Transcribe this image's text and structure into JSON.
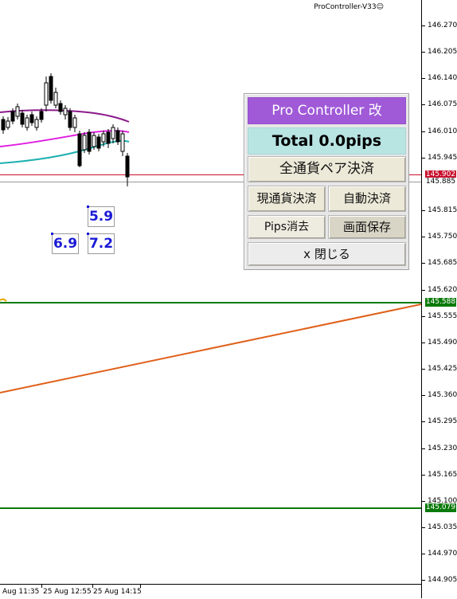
{
  "indicator": {
    "name": "ProController-V33",
    "smiley_icon": "smiley-icon"
  },
  "price_axis": {
    "labels": [
      "146.270",
      "146.205",
      "146.140",
      "146.075",
      "146.010",
      "145.945",
      "145.815",
      "145.750",
      "145.685",
      "145.620",
      "145.555",
      "145.490",
      "145.425",
      "145.360",
      "145.295",
      "145.230",
      "145.165",
      "145.100",
      "145.035",
      "144.970",
      "144.905"
    ],
    "bid_tag": "145.902",
    "ask_tag": "145.885",
    "level_upper_tag": "145.588",
    "level_lower_tag": "145.079"
  },
  "time_axis": {
    "labels": [
      "Aug 11:35",
      "25 Aug 12:55",
      "25 Aug 14:15"
    ]
  },
  "pip_labels": [
    "5.9",
    "6.9",
    "7.2"
  ],
  "panel": {
    "title": "Pro Controller 改",
    "total": "Total    0.0pips",
    "close_all": "全通貨ペア決済",
    "close_current": "現通貨決済",
    "auto_close": "自動決済",
    "pips_clear": "Pips消去",
    "screen_save": "画面保存",
    "close_panel": "x 閉じる"
  },
  "colors": {
    "bid_line": "#c8102e",
    "level_line": "#0a7a0a",
    "trend_line": "#e0601a",
    "ma_slow": "#8b1a8b",
    "ma_mid": "#e020e0",
    "ma_fast": "#20b0b0",
    "title_bg": "#a05ad8",
    "total_bg": "#b8e4e2"
  }
}
